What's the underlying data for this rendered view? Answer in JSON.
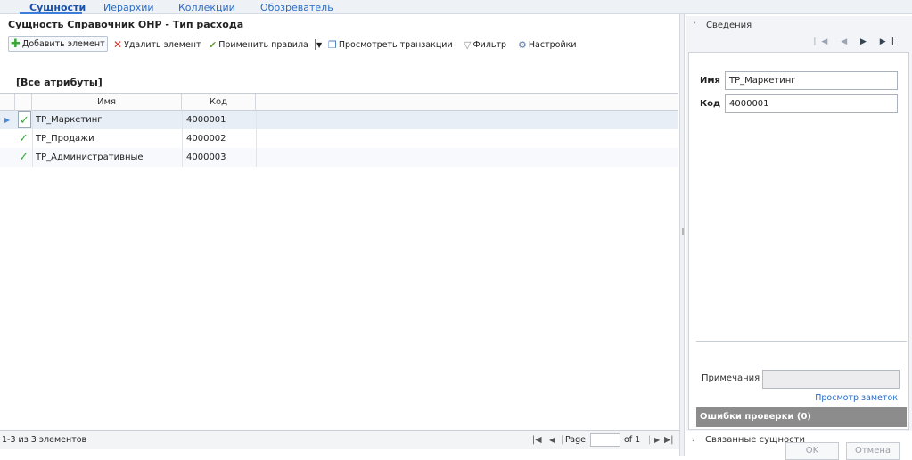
{
  "tabs": [
    {
      "label": "Сущности",
      "active": true
    },
    {
      "label": "Иерархии"
    },
    {
      "label": "Коллекции"
    },
    {
      "label": "Обозреватель"
    }
  ],
  "page_title": "Сущность Справочник ОНР - Тип расхода",
  "toolbar": {
    "add": "Добавить элемент",
    "delete": "Удалить элемент",
    "apply_rules": "Применить правила",
    "view_transactions": "Просмотреть транзакции",
    "filter": "Фильтр",
    "settings": "Настройки"
  },
  "attributes_label": "[Все атрибуты]",
  "grid": {
    "columns": [
      "Имя",
      "Код"
    ],
    "rows": [
      {
        "name": "ТР_Маркетинг",
        "code": "4000001"
      },
      {
        "name": "ТР_Продажи",
        "code": "4000002"
      },
      {
        "name": "ТР_Административные",
        "code": "4000003"
      }
    ]
  },
  "footer": {
    "count": "1-3 из 3 элементов",
    "page_label": "Page",
    "of_label": "of 1"
  },
  "details": {
    "title": "Сведения",
    "name_label": "Имя",
    "name_value": "ТР_Маркетинг",
    "code_label": "Код",
    "code_value": "4000001",
    "notes_label": "Примечания",
    "notes_link": "Просмотр заметок",
    "errors": "Ошибки проверки (0)",
    "ok": "OK",
    "cancel": "Отмена"
  },
  "related": "Связанные сущности",
  "colors": {
    "accent": "#2a6cc4",
    "check": "#3aa53a",
    "errors_bg": "#8c8c8c"
  }
}
